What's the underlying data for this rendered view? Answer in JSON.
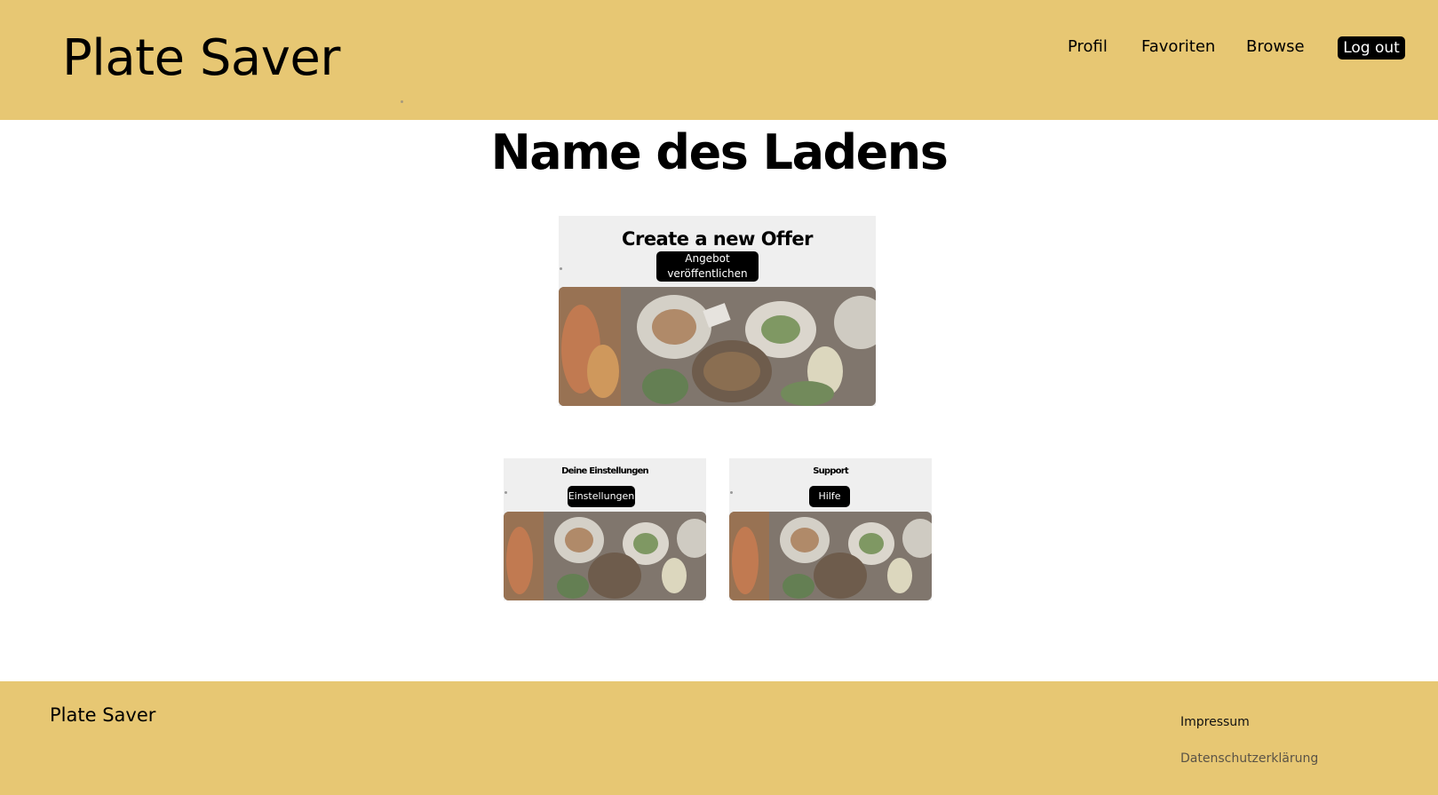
{
  "header": {
    "logo": "Plate Saver",
    "nav": {
      "profil": "Profil",
      "favoriten": "Favoriten",
      "browse": "Browse",
      "logout": "Log out"
    }
  },
  "page": {
    "store_name": "Name des Ladens"
  },
  "cards": {
    "offer": {
      "title": "Create a new Offer",
      "button": "Angebot veröffentlichen"
    },
    "settings": {
      "title": "Deine Einstellungen",
      "button": "Einstellungen"
    },
    "support": {
      "title": "Support",
      "button": "Hilfe"
    }
  },
  "footer": {
    "logo": "Plate Saver",
    "impressum": "Impressum",
    "datenschutz": "Datenschutzerklärung"
  },
  "colors": {
    "brand": "#e7c773",
    "button": "#000000",
    "card": "#efefef"
  }
}
